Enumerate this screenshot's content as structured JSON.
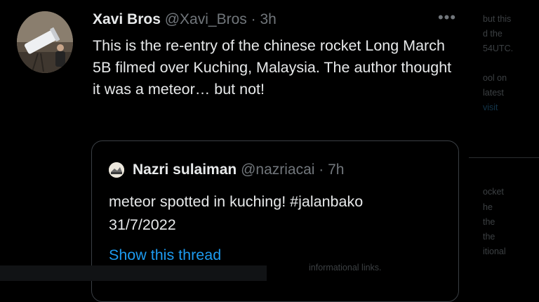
{
  "tweet": {
    "author_name": "Xavi Bros",
    "handle": "@Xavi_Bros",
    "separator": "·",
    "time": "3h",
    "text": "This is the re-entry of the chinese rocket Long March 5B filmed over Kuching, Malaysia. The author thought it was a meteor… but not!",
    "more_icon": "more-horizontal-icon",
    "more_glyph": "•••"
  },
  "quoted_tweet": {
    "author_name": "Nazri sulaiman",
    "handle": "@nazriacai",
    "separator": "·",
    "time": "7h",
    "text_line1": "meteor spotted in kuching! #jalanbako",
    "text_line2": "31/7/2022",
    "show_thread_label": "Show this thread"
  },
  "background_fragments": {
    "right": [
      "but this",
      "d the",
      "54UTC.",
      "ool on",
      "latest",
      "visit",
      "ocket",
      "he",
      "the",
      "the",
      "itional"
    ],
    "bottom": "informational links."
  },
  "colors": {
    "background": "#000000",
    "text_primary": "#e7e9ea",
    "text_muted": "#71767b",
    "link": "#1d9bf0",
    "card_border": "#3a3f44"
  }
}
